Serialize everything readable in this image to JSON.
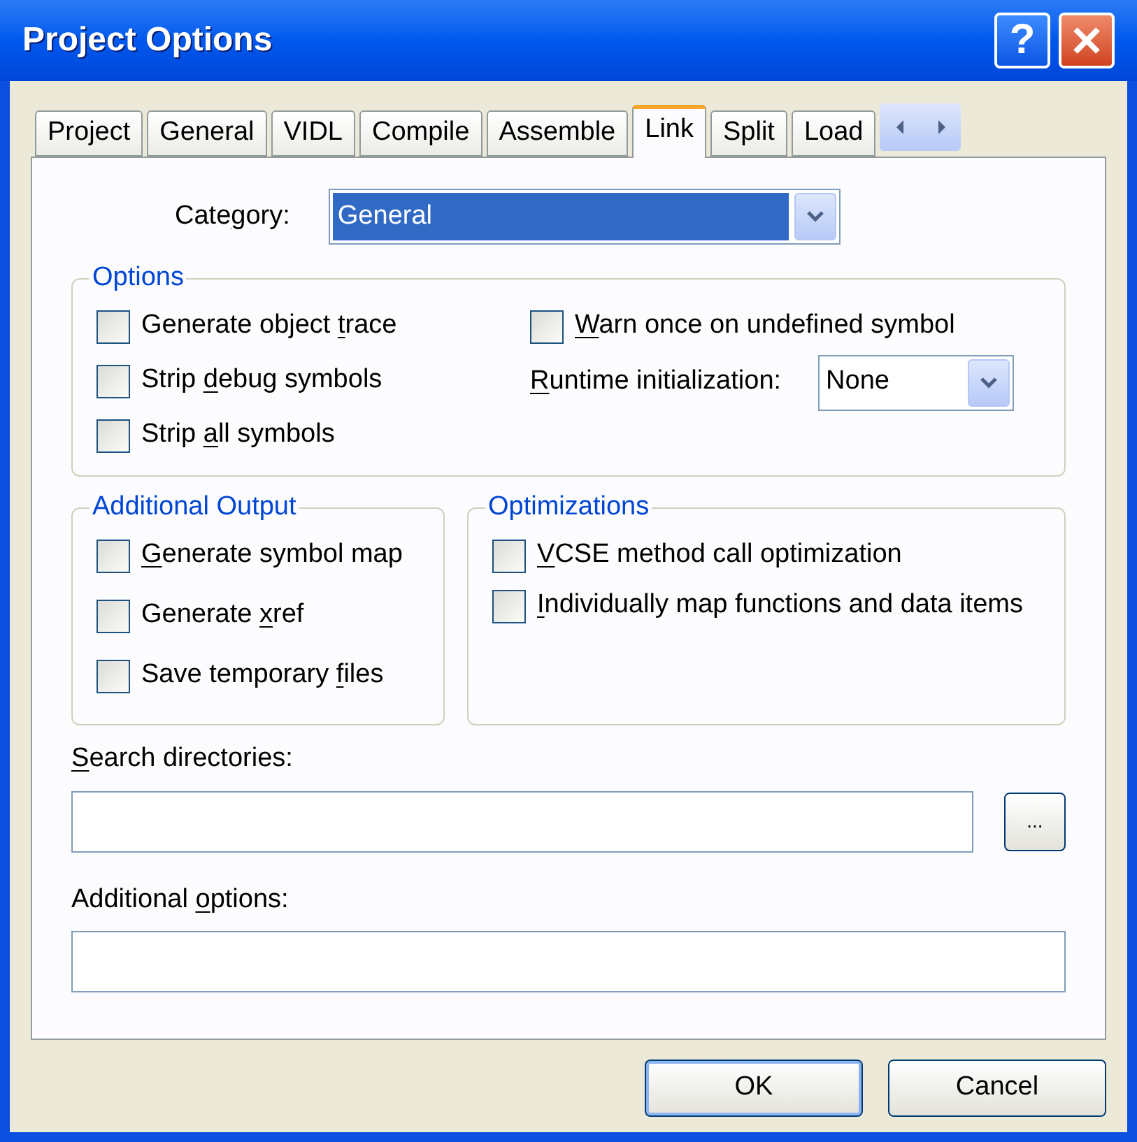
{
  "window": {
    "title": "Project Options",
    "help_button": "?"
  },
  "tabs": [
    {
      "label": "Project",
      "selected": false
    },
    {
      "label": "General",
      "selected": false
    },
    {
      "label": "VIDL",
      "selected": false
    },
    {
      "label": "Compile",
      "selected": false
    },
    {
      "label": "Assemble",
      "selected": false
    },
    {
      "label": "Link",
      "selected": true
    },
    {
      "label": "Split",
      "selected": false
    },
    {
      "label": "Load",
      "selected": false
    }
  ],
  "category": {
    "label": {
      "pre": "Cate",
      "key": "g",
      "post": "ory:"
    },
    "value": "General",
    "highlighted": true
  },
  "options": {
    "title": "Options",
    "left": [
      {
        "kind": "checkbox",
        "checked": false,
        "label": {
          "pre": "Generate object ",
          "key": "t",
          "post": "race"
        }
      },
      {
        "kind": "checkbox",
        "checked": false,
        "label": {
          "pre": "Strip ",
          "key": "d",
          "post": "ebug symbols"
        }
      },
      {
        "kind": "checkbox",
        "checked": false,
        "label": {
          "pre": "Strip ",
          "key": "a",
          "post": "ll symbols"
        }
      }
    ],
    "right": [
      {
        "kind": "checkbox",
        "checked": false,
        "label": {
          "key": "W",
          "post": "arn once on undefined symbol"
        }
      },
      {
        "kind": "dropdown",
        "label": {
          "key": "R",
          "post": "untime initialization:"
        },
        "value": "None"
      }
    ]
  },
  "additional_output": {
    "title": "Additional Output",
    "items": [
      {
        "kind": "checkbox",
        "checked": false,
        "label": {
          "key": "G",
          "post": "enerate symbol map"
        }
      },
      {
        "kind": "checkbox",
        "checked": false,
        "label": {
          "pre": "Generate ",
          "key": "x",
          "post": "ref"
        }
      },
      {
        "kind": "checkbox",
        "checked": false,
        "label": {
          "pre": "Save temporary ",
          "key": "f",
          "post": "iles"
        }
      }
    ]
  },
  "optimizations": {
    "title": "Optimizations",
    "items": [
      {
        "kind": "checkbox",
        "checked": false,
        "label": {
          "key": "V",
          "post": "CSE method call optimization"
        }
      },
      {
        "kind": "checkbox",
        "checked": false,
        "label": {
          "key": "I",
          "post": "ndividually map functions and data items"
        }
      }
    ]
  },
  "search_directories": {
    "label": {
      "key": "S",
      "post": "earch directories:"
    },
    "browse_button": "..."
  },
  "additional_options": {
    "label": {
      "pre": "Additional ",
      "key": "o",
      "post": "ptions:"
    }
  },
  "buttons": [
    {
      "label": "OK",
      "default": true
    },
    {
      "label": "Cancel",
      "default": false
    }
  ]
}
